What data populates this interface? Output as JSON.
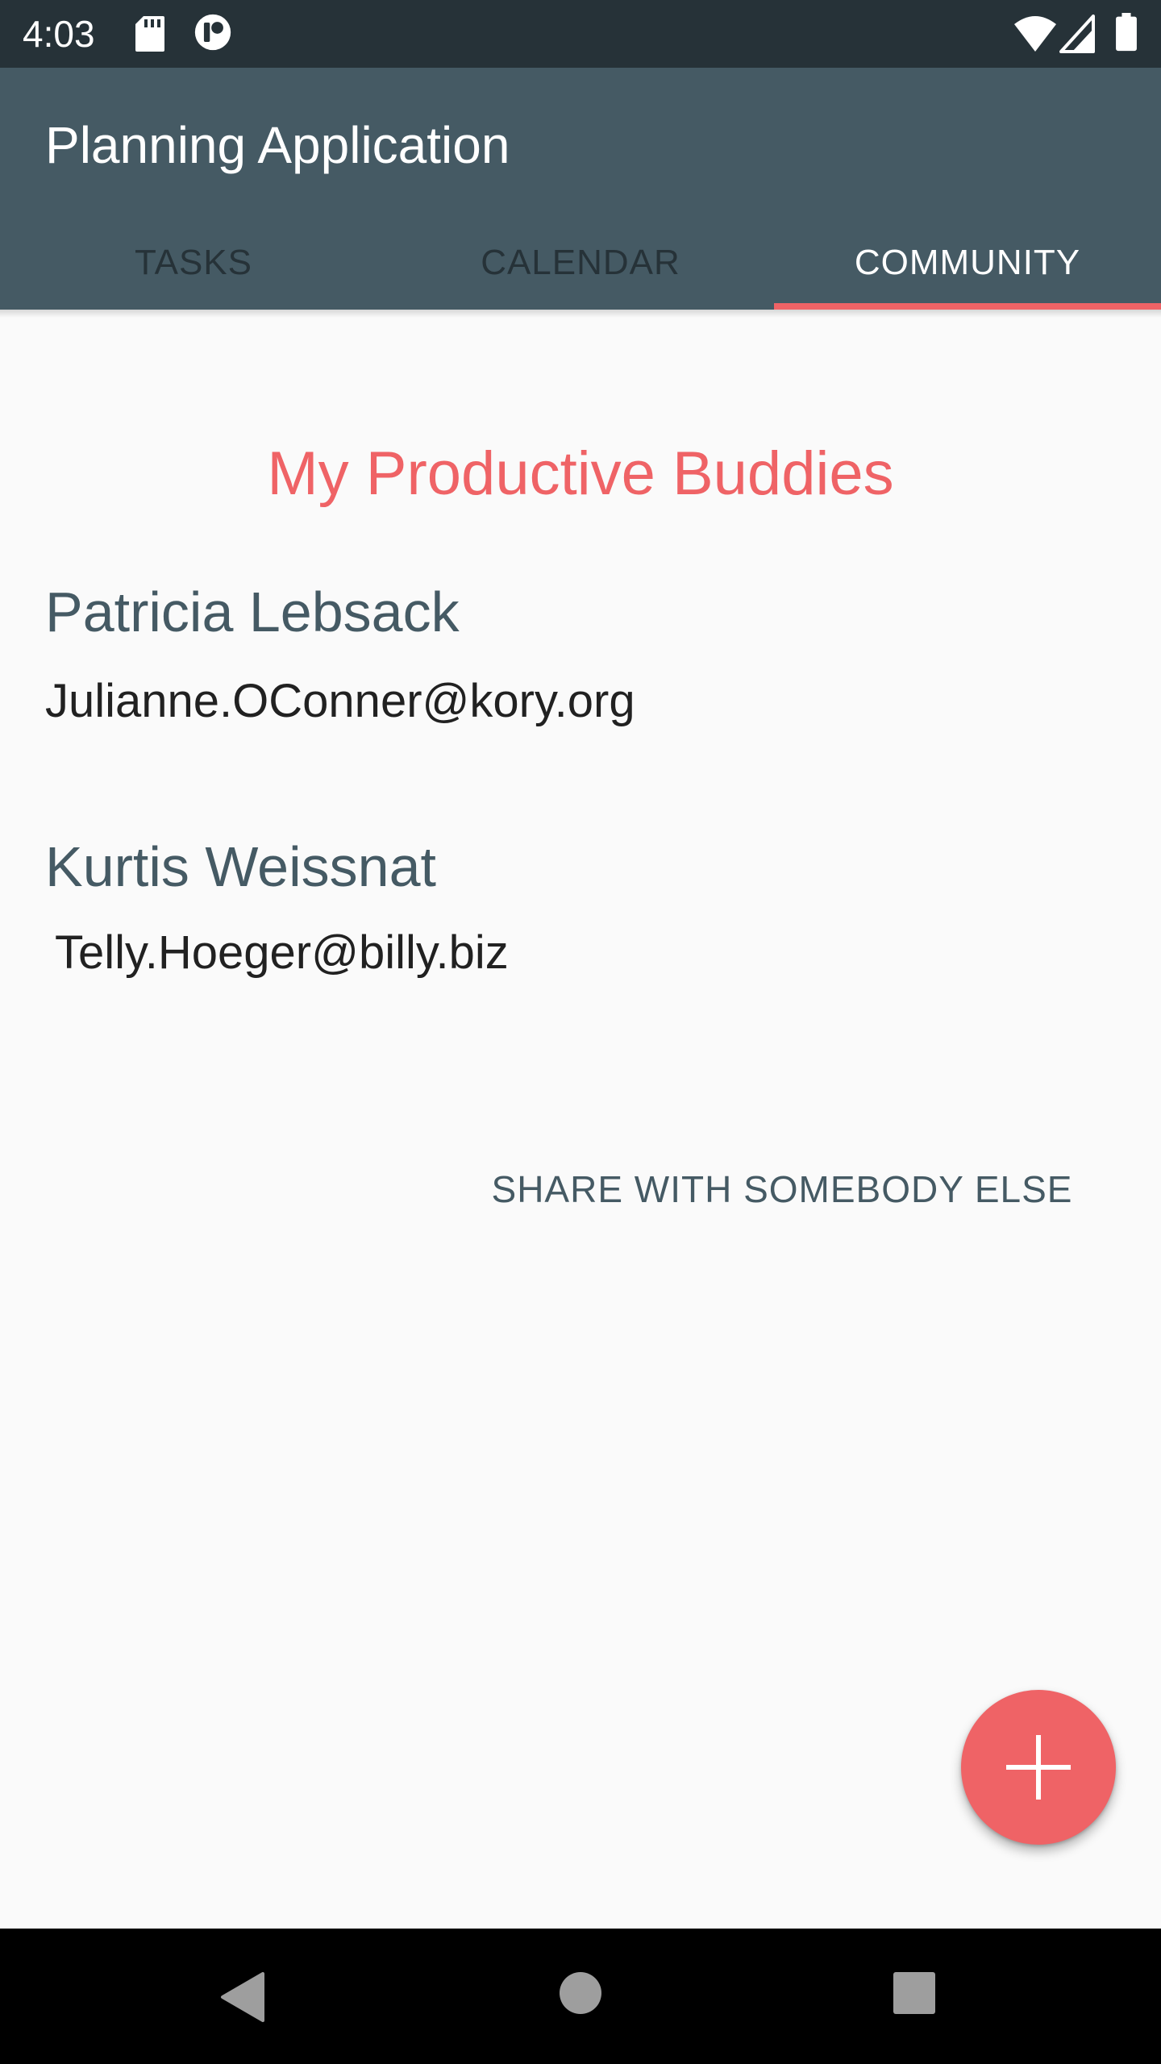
{
  "status_bar": {
    "time": "4:03",
    "icons": [
      "sd-card-icon",
      "notification-app-icon",
      "wifi-icon",
      "cell-signal-icon",
      "battery-icon"
    ]
  },
  "app_bar": {
    "title": "Planning Application",
    "tabs": [
      {
        "label": "TASKS",
        "active": false
      },
      {
        "label": "CALENDAR",
        "active": false
      },
      {
        "label": "COMMUNITY",
        "active": true
      }
    ]
  },
  "community": {
    "title": "My Productive Buddies",
    "buddies": [
      {
        "name": "Patricia Lebsack",
        "email": "Julianne.OConner@kory.org"
      },
      {
        "name": "Kurtis Weissnat",
        "email": "Telly.Hoeger@billy.biz"
      }
    ],
    "share_label": "SHARE WITH SOMEBODY ELSE"
  },
  "fab": {
    "icon": "plus-icon"
  },
  "nav_bar": {
    "buttons": [
      "back-icon",
      "home-icon",
      "recents-icon"
    ]
  },
  "colors": {
    "status_bar": "#263238",
    "app_bar": "#455a64",
    "accent": "#ef6366",
    "background": "#fafafa",
    "nav_bar": "#000000"
  }
}
